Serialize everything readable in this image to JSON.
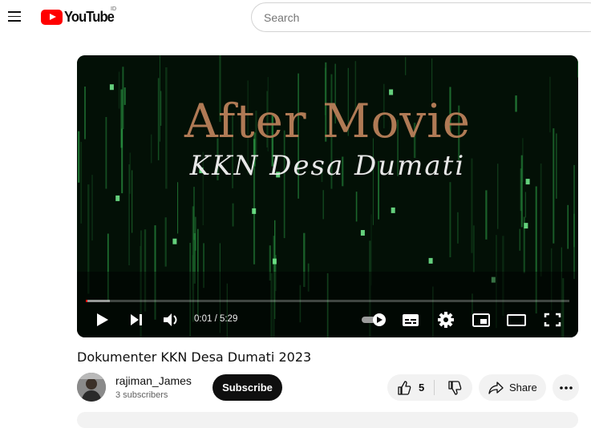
{
  "header": {
    "logo_text": "YouTube",
    "country_code": "ID",
    "search_placeholder": "Search"
  },
  "player": {
    "overlay_title": "After Movie",
    "overlay_subtitle": "KKN Desa Dumati",
    "current_time": "0:01",
    "duration": "5:29",
    "time_display": "0:01 / 5:29",
    "played_fraction": 0.003,
    "buffered_fraction": 0.05,
    "autoplay_on": true
  },
  "video": {
    "title": "Dokumenter KKN Desa Dumati 2023",
    "channel_name": "rajiman_James",
    "subscribers": "3 subscribers",
    "subscribe_label": "Subscribe",
    "like_count": "5",
    "share_label": "Share"
  },
  "colors": {
    "brand_red": "#ff0000",
    "matrix_green": "#2fa84a",
    "title_bronze": "#b07a55"
  },
  "icons": [
    "menu-icon",
    "youtube-logo-icon",
    "play-icon",
    "next-icon",
    "volume-icon",
    "autoplay-toggle-icon",
    "captions-icon",
    "settings-icon",
    "miniplayer-icon",
    "theater-mode-icon",
    "fullscreen-icon",
    "like-icon",
    "dislike-icon",
    "share-icon",
    "more-icon"
  ]
}
